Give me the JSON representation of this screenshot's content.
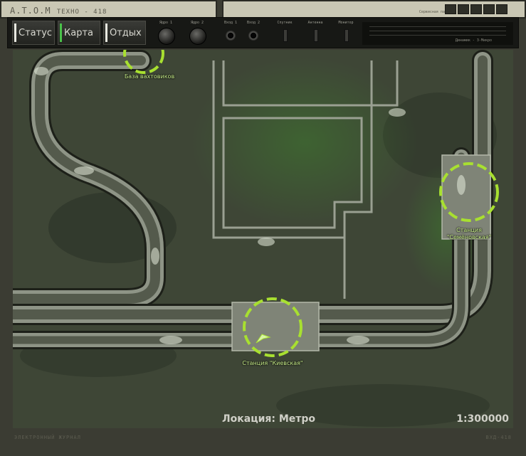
{
  "device": {
    "brand": "A.T.O.M",
    "model": "ТЕХНО - 418",
    "top_right_label": "Сервисная панель"
  },
  "toolbar": {
    "tabs": [
      {
        "label": "Статус",
        "active": false
      },
      {
        "label": "Карта",
        "active": true
      },
      {
        "label": "Отдых",
        "active": false
      }
    ],
    "controls": {
      "knob1_label": "Ядро 1",
      "knob2_label": "Ядро 2",
      "jack1_label": "Вход 1",
      "jack2_label": "Вход 2",
      "switch1_label": "Спутник",
      "switch2_label": "Антенна",
      "switch3_label": "Монитор"
    },
    "meter_label": "Динамик - 3-Микро"
  },
  "map": {
    "markers": [
      {
        "name": "base",
        "label": "База вахтовиков"
      },
      {
        "name": "semenovskaya",
        "label_line1": "Станция",
        "label_line2": "\"Семёновская\""
      },
      {
        "name": "kievskaya",
        "label": "Станция \"Киевская\""
      }
    ],
    "location_text": "Локация: Метро",
    "scale_text": "1:300000",
    "colors": {
      "marker": "#a8e030",
      "ground": "#3e4636",
      "road": "#8e9486"
    }
  },
  "footer": {
    "left": "ЭЛЕКТРОННЫЙ ЖУРНАЛ",
    "right": "ВХД-418"
  }
}
